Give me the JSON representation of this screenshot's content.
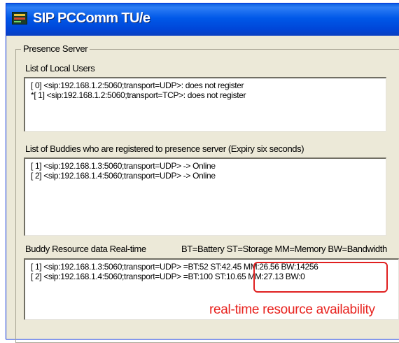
{
  "window": {
    "title": "SIP PCComm TU/e"
  },
  "presence_server": {
    "label": "Presence Server",
    "local_users": {
      "label": "List of Local Users",
      "items": [
        "[ 0] <sip:192.168.1.2:5060;transport=UDP>: does not register",
        "*[ 1] <sip:192.168.1.2:5060;transport=TCP>: does not register"
      ]
    },
    "buddies": {
      "label": "List of Buddies who are registered to presence server (Expiry six seconds)",
      "items": [
        "[ 1] <sip:192.168.1.3:5060;transport=UDP> -> Online",
        "[ 2] <sip:192.168.1.4:5060;transport=UDP> -> Online"
      ]
    },
    "resource": {
      "label": "Buddy Resource data  Real-time",
      "legend": "BT=Battery ST=Storage MM=Memory BW=Bandwidth",
      "items": [
        {
          "uri": "[ 1] <sip:192.168.1.3:5060;transport=UDP> =",
          "data": "BT:52 ST:42.45 MM:26.56 BW:14256"
        },
        {
          "uri": "[ 2] <sip:192.168.1.4:5060;transport=UDP> =",
          "data": "BT:100 ST:10.65 MM:27.13 BW:0"
        }
      ]
    }
  },
  "annotation": {
    "text": "real-time resource availability",
    "color": "#e8231f"
  },
  "colors": {
    "titlebar": "#0058e8",
    "window_bg": "#ece9d8",
    "annotation_border": "#e02020"
  }
}
